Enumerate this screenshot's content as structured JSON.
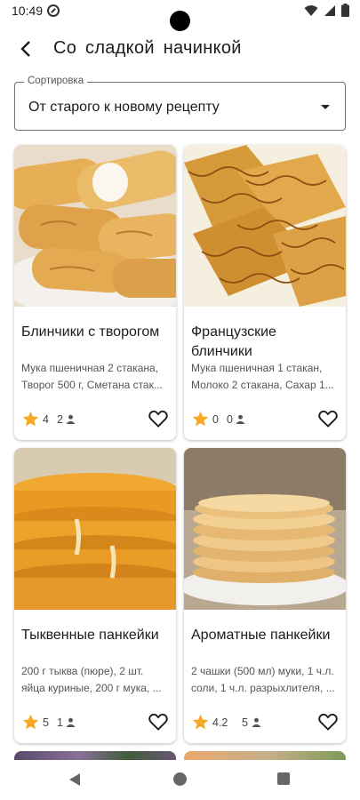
{
  "status": {
    "time": "10:49"
  },
  "header": {
    "title": "Со  сладкой  начинкой"
  },
  "sort": {
    "label": "Сортировка",
    "value": "От старого к новому рецепту"
  },
  "recipes": [
    {
      "title": "Блинчики с творогом",
      "description": "Мука пшеничная 2 стакана, Творог 500 г, Сметана стак...",
      "rating": "4",
      "count": "2"
    },
    {
      "title": "Французские блинчики",
      "description": "Мука пшеничная 1 стакан, Молоко 2 стакана, Сахар 1...",
      "rating": "0",
      "count": "0"
    },
    {
      "title": "Тыквенные панкейки",
      "description": "200 г тыква (пюре), 2 шт. яйца куриные, 200 г мука, ...",
      "rating": "5",
      "count": "1"
    },
    {
      "title": "Ароматные панкейки",
      "description": "2 чашки (500 мл) муки, 1 ч.л. соли, 1 ч.л. разрыхлителя, ...",
      "rating": "4.2",
      "count": "5"
    }
  ],
  "colors": {
    "star": "#f9a825",
    "accent": "#1c1b1f"
  },
  "icons": {
    "back": "arrow-back-icon",
    "dropdown": "dropdown-arrow-icon",
    "rating": "star-icon",
    "favorite": "heart-outline-icon",
    "people": "person-icon"
  }
}
